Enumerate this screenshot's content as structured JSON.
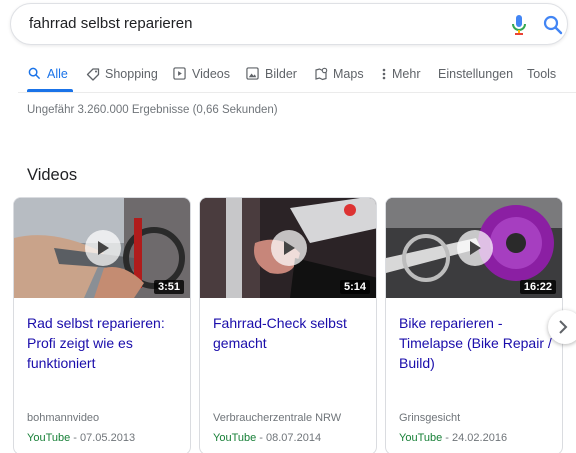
{
  "search": {
    "query": "fahrrad selbst reparieren"
  },
  "tabs": [
    {
      "label": "Alle",
      "icon": "search-icon",
      "active": true
    },
    {
      "label": "Shopping",
      "icon": "tag-icon"
    },
    {
      "label": "Videos",
      "icon": "play-square-icon"
    },
    {
      "label": "Bilder",
      "icon": "image-icon"
    },
    {
      "label": "Maps",
      "icon": "map-pin-icon"
    },
    {
      "label": "Mehr",
      "icon": "more-vert-icon"
    },
    {
      "label": "Einstellungen"
    },
    {
      "label": "Tools"
    }
  ],
  "result_stats": "Ungefähr 3.260.000 Ergebnisse (0,66 Sekunden)",
  "videos_section": {
    "title": "Videos",
    "cards": [
      {
        "duration": "3:51",
        "title": "Rad selbst reparieren: Profi zeigt wie es funktioniert",
        "source": "bohmannvideo",
        "platform": "YouTube",
        "date": " - 07.05.2013"
      },
      {
        "duration": "5:14",
        "title": "Fahrrad-Check selbst gemacht",
        "source": "Verbraucherzentrale NRW",
        "platform": "YouTube",
        "date": " - 08.07.2014"
      },
      {
        "duration": "16:22",
        "title": "Bike reparieren - Timelapse (Bike Repair / Build)",
        "source": "Grinsgesicht",
        "platform": "YouTube",
        "date": " - 24.02.2016"
      }
    ]
  },
  "colors": {
    "accent": "#1a73e8",
    "link": "#1a0dab",
    "url_green": "#188038",
    "muted": "#70757a"
  }
}
